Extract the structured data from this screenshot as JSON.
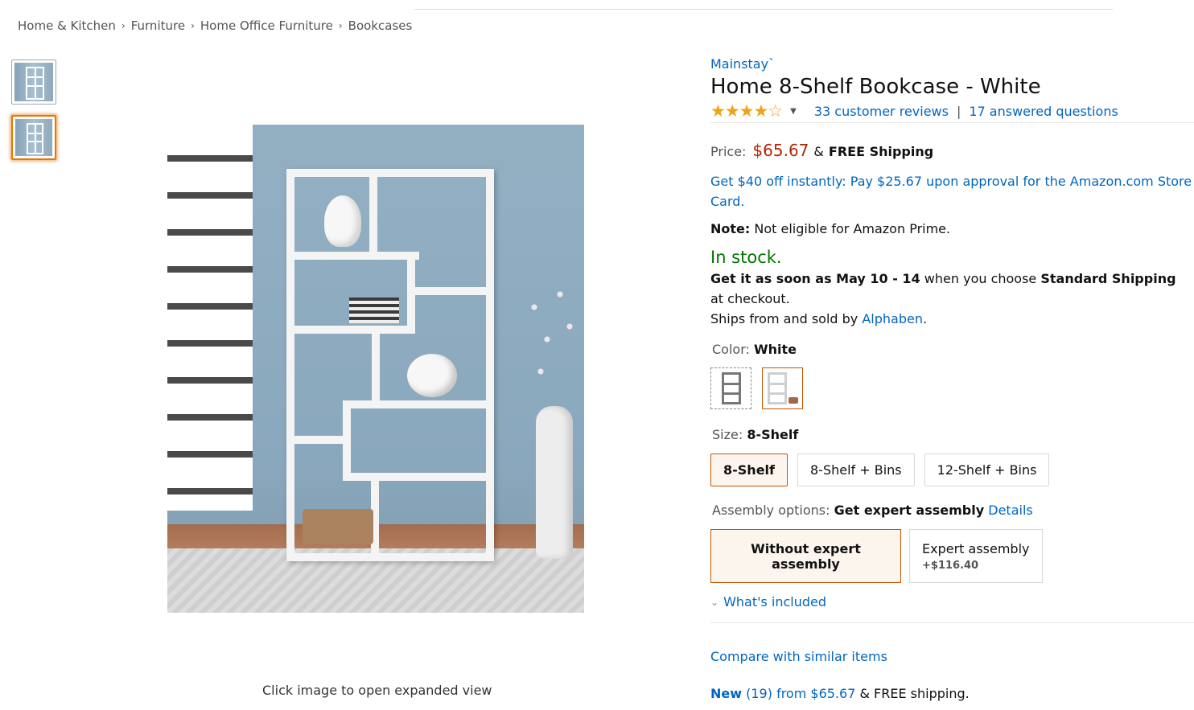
{
  "breadcrumb": {
    "items": [
      "Home & Kitchen",
      "Furniture",
      "Home Office Furniture",
      "Bookcases"
    ],
    "separator": "›"
  },
  "gallery": {
    "caption": "Click image to open expanded view",
    "thumbnails": [
      "thumbnail-1",
      "thumbnail-2"
    ],
    "selected_thumbnail": 2
  },
  "product": {
    "brand": "Mainstay`",
    "title": "Home 8-Shelf Bookcase - White",
    "rating": 4,
    "rating_stars": "★★★★☆",
    "reviews_link": "33 customer reviews",
    "qa_link": "17 answered questions",
    "price_label": "Price:",
    "price": "$65.67",
    "amp": "&",
    "shipping": "FREE Shipping",
    "promo": "Get $40 off instantly: Pay $25.67 upon approval for the Amazon.com Store Card.",
    "note_label": "Note:",
    "note_text": "Not eligible for Amazon Prime.",
    "stock": "In stock.",
    "delivery": {
      "prefix": "Get it as soon as May 10 - 14",
      "middle": "when you choose",
      "method": "Standard Shipping",
      "suffix": "at checkout.",
      "ships_prefix": "Ships from and sold by",
      "seller": "Alphaben",
      "ships_suffix": "."
    },
    "color": {
      "label": "Color:",
      "value": "White",
      "swatches": [
        "shelf-dark-outline",
        "shelf-white-with-bins"
      ],
      "selected_index": 1
    },
    "size": {
      "label": "Size:",
      "value": "8-Shelf",
      "options": [
        "8-Shelf",
        "8-Shelf + Bins",
        "12-Shelf + Bins"
      ],
      "selected_index": 0
    },
    "assembly": {
      "label": "Assembly options:",
      "value": "Get expert assembly",
      "details_link": "Details",
      "options": [
        {
          "label": "Without expert assembly",
          "price": ""
        },
        {
          "label": "Expert assembly",
          "price": "+$116.40"
        }
      ],
      "selected_index": 0,
      "whats_included": "What's included"
    },
    "compare_link": "Compare with similar items",
    "new_offers": {
      "label": "New",
      "count": "(19)",
      "from_text": "from $65.67",
      "suffix": "& FREE shipping."
    }
  },
  "colors": {
    "link": "#0066c0",
    "price": "#b12704",
    "in_stock": "#007600",
    "star": "#f0a313",
    "selected_border": "#c45500"
  }
}
